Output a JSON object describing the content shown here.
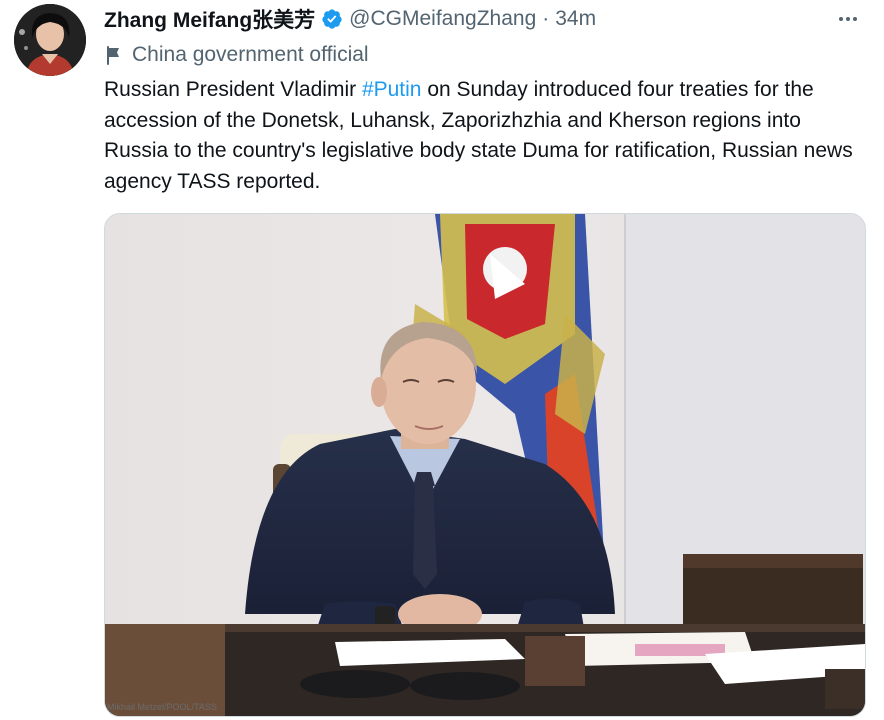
{
  "tweet": {
    "display_name": "Zhang Meifang张美芳",
    "handle": "@CGMeifangZhang",
    "separator": "·",
    "time": "34m",
    "affiliation_label": "China government official",
    "text_before_hashtag": "Russian President Vladimir ",
    "hashtag": "#Putin",
    "text_after_hashtag": " on Sunday introduced four treaties for the accession of the Donetsk, Luhansk, Zaporizhzhia and Kherson regions into Russia to the country's legislative body state Duma for ratification, Russian news agency TASS reported.",
    "photo_credit": "Mikhail Metzel/POOL/TASS"
  },
  "icons": {
    "verified": "verified-badge-icon",
    "more": "more-options-icon",
    "affiliation": "flag-icon"
  },
  "colors": {
    "link": "#1d9bf0",
    "verified": "#1d9bf0",
    "secondary_text": "#536471",
    "primary_text": "#0f1419"
  }
}
